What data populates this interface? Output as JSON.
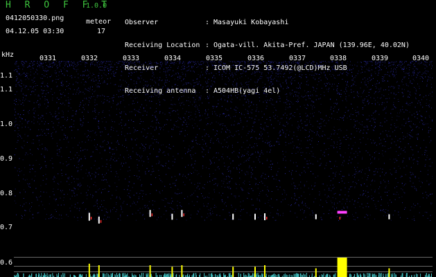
{
  "header": {
    "app_title": "H R O F F T",
    "app_version": "1.0.0",
    "filename": "0412050330.png",
    "meteor_label": "meteor",
    "meteor_count": "17",
    "datetime": "04.12.05 03:30"
  },
  "info": [
    {
      "key": "Observer",
      "value": "Masayuki Kobayashi"
    },
    {
      "key": "Receiving Location",
      "value": "Ogata-vill. Akita-Pref. JAPAN (139.96E, 40.02N)"
    },
    {
      "key": "Receiver",
      "value": "ICOM IC-575 53.7492(@LCD)MHz USB"
    },
    {
      "key": "Receiving antenna",
      "value": "A504HB(yagi 4el)"
    }
  ],
  "axis": {
    "unit_label": "kHz",
    "time_ticks": [
      "0331",
      "0332",
      "0333",
      "0334",
      "0335",
      "0336",
      "0337",
      "0338",
      "0339",
      "0340"
    ],
    "freq_ticks": [
      {
        "label": "1.1",
        "value": 1.15
      },
      {
        "label": "1.1",
        "value": 1.1
      },
      {
        "label": "1.0",
        "value": 1.0
      },
      {
        "label": "0.9",
        "value": 0.9
      },
      {
        "label": "0.8",
        "value": 0.8
      },
      {
        "label": "0.7",
        "value": 0.72
      },
      {
        "label": "0.6",
        "value": 0.6
      }
    ]
  },
  "colors": {
    "header_text": "#3ec43e",
    "noise": "#2a2aa8",
    "echo_white": "#ffffff",
    "echo_red": "#ff3030",
    "echo_magenta": "#ff40ff",
    "peak_yellow": "#ffff00",
    "baseline_cyan": "#40c0c0",
    "grid_line": "#808080"
  },
  "meteor_echoes": [
    {
      "time": "0332",
      "freq": 0.72,
      "strength": 0.6
    },
    {
      "time": "0332",
      "freq": 0.71,
      "strength": 0.5
    },
    {
      "time": "0333",
      "freq": 0.73,
      "strength": 0.5
    },
    {
      "time": "0334",
      "freq": 0.72,
      "strength": 0.4
    },
    {
      "time": "0334",
      "freq": 0.73,
      "strength": 0.5
    },
    {
      "time": "0335",
      "freq": 0.72,
      "strength": 0.4
    },
    {
      "time": "0336",
      "freq": 0.72,
      "strength": 0.4
    },
    {
      "time": "0336",
      "freq": 0.72,
      "strength": 0.5
    },
    {
      "time": "0337",
      "freq": 0.72,
      "strength": 0.3
    },
    {
      "time": "0338",
      "freq": 0.72,
      "strength": 1.0
    },
    {
      "time": "0339",
      "freq": 0.72,
      "strength": 0.3
    },
    {
      "time": "0340",
      "freq": 0.72,
      "strength": 0.4
    }
  ]
}
